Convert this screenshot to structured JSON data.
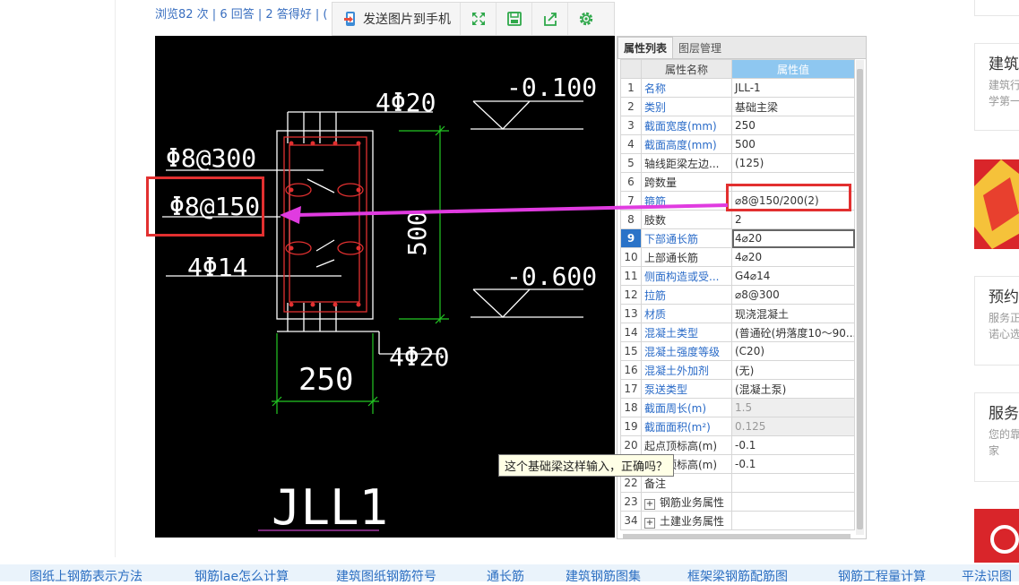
{
  "stats": "浏览82 次 | 6 回答 | 2 答得好 | (",
  "toolbar": {
    "send_label": "发送图片到手机",
    "icons": [
      "fullscreen-icon",
      "save-icon",
      "share-icon",
      "settings-icon"
    ]
  },
  "cad": {
    "label_top_rebar": "4Φ20",
    "label_elev1": "-0.100",
    "label_stirrup_300": "Φ8@300",
    "label_stirrup_150": "Φ8@150",
    "label_height": "500",
    "label_side": "4Φ14",
    "label_elev2": "-0.600",
    "label_width": "250",
    "label_bottom_rebar": "4Φ20",
    "label_beam": "JLL1"
  },
  "panel": {
    "tab_props": "属性列表",
    "tab_layers": "图层管理",
    "col_name": "属性名称",
    "col_value": "属性值",
    "rows": [
      {
        "n": "1",
        "name": "名称",
        "value": "JLL-1"
      },
      {
        "n": "2",
        "name": "类别",
        "value": "基础主梁"
      },
      {
        "n": "3",
        "name": "截面宽度(mm)",
        "value": "250"
      },
      {
        "n": "4",
        "name": "截面高度(mm)",
        "value": "500"
      },
      {
        "n": "5",
        "name": "轴线距梁左边...",
        "value": "(125)"
      },
      {
        "n": "6",
        "name": "跨数量",
        "value": ""
      },
      {
        "n": "7",
        "name": "箍筋",
        "value": "⌀8@150/200(2)"
      },
      {
        "n": "8",
        "name": "肢数",
        "value": "2"
      },
      {
        "n": "9",
        "name": "下部通长筋",
        "value": "4⌀20"
      },
      {
        "n": "10",
        "name": "上部通长筋",
        "value": "4⌀20"
      },
      {
        "n": "11",
        "name": "侧面构造或受...",
        "value": "G4⌀14"
      },
      {
        "n": "12",
        "name": "拉筋",
        "value": "⌀8@300"
      },
      {
        "n": "13",
        "name": "材质",
        "value": "现浇混凝土"
      },
      {
        "n": "14",
        "name": "混凝土类型",
        "value": "(普通砼(坍落度10～90..."
      },
      {
        "n": "15",
        "name": "混凝土强度等级",
        "value": "(C20)"
      },
      {
        "n": "16",
        "name": "混凝土外加剂",
        "value": "(无)"
      },
      {
        "n": "17",
        "name": "泵送类型",
        "value": "(混凝土泵)"
      },
      {
        "n": "18",
        "name": "截面周长(m)",
        "value": "1.5"
      },
      {
        "n": "19",
        "name": "截面面积(m²)",
        "value": "0.125"
      },
      {
        "n": "20",
        "name": "起点顶标高(m)",
        "value": "-0.1"
      },
      {
        "n": "21",
        "name": "终点顶标高(m)",
        "value": "-0.1"
      },
      {
        "n": "22",
        "name": "备注",
        "value": ""
      },
      {
        "n": "23",
        "name": "钢筋业务属性",
        "value": ""
      },
      {
        "n": "34",
        "name": "土建业务属性",
        "value": ""
      }
    ]
  },
  "tooltip": "这个基础梁这样输入，正确吗？",
  "right_cards": [
    {
      "title": "建筑",
      "desc1": "建筑行",
      "desc2": "学第一"
    },
    {
      "title": "预约",
      "desc1": "服务正",
      "desc2": "诺心选"
    },
    {
      "title": "服务",
      "desc1": "您的靠",
      "desc2": "家"
    }
  ],
  "bottom_links": [
    "图纸上钢筋表示方法",
    "钢筋lae怎么计算",
    "建筑图纸钢筋符号",
    "通长筋",
    "建筑钢筋图集",
    "框架梁钢筋配筋图",
    "钢筋工程量计算",
    "平法识图"
  ]
}
